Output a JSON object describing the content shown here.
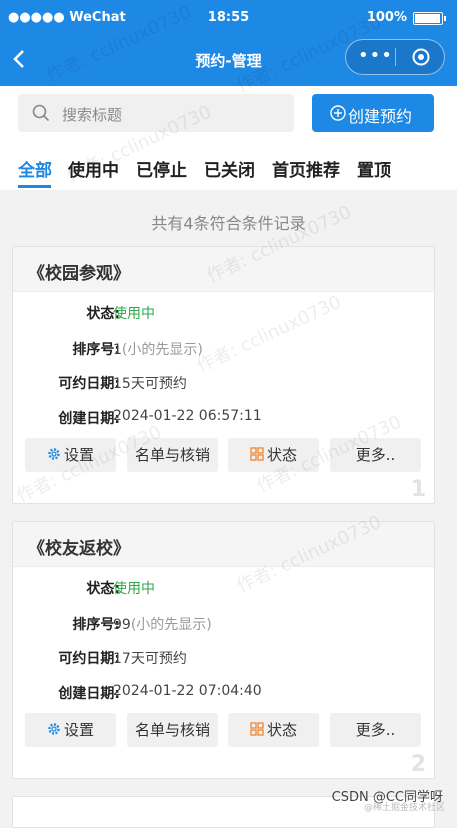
{
  "status": {
    "signal": "●●●●● WeChat",
    "time": "18:55",
    "battery": "100%"
  },
  "nav": {
    "title": "预约-管理",
    "menu_dots": "•••"
  },
  "search": {
    "placeholder": "搜索标题",
    "create_label": "创建预约"
  },
  "tabs": [
    "全部",
    "使用中",
    "已停止",
    "已关闭",
    "首页推荐",
    "置顶"
  ],
  "summary": "共有4条符合条件记录",
  "labels": {
    "status": "状态:",
    "order": "排序号:",
    "days": "可约日期:",
    "created": "创建日期:"
  },
  "hint": "(小的先显示)",
  "buttons": {
    "settings": "设置",
    "list": "名单与核销",
    "state": "状态",
    "more": "更多.."
  },
  "cards": [
    {
      "title": "《校园参观》",
      "status": "使用中",
      "order": "1",
      "days": "15天可预约",
      "created": "2024-01-22 06:57:11",
      "num": "1"
    },
    {
      "title": "《校友返校》",
      "status": "使用中",
      "order": "99",
      "days": "17天可预约",
      "created": "2024-01-22 07:04:40",
      "num": "2"
    }
  ],
  "watermark": "作者: cclinux0730",
  "credit": "CSDN @CC同学呀",
  "credit_small": "@稀土掘金技术社区",
  "colors": {
    "primary": "#1e88e5",
    "active_green": "#2ea84a",
    "gear": "#1e88e5",
    "state_icon": "#f08c3c"
  }
}
